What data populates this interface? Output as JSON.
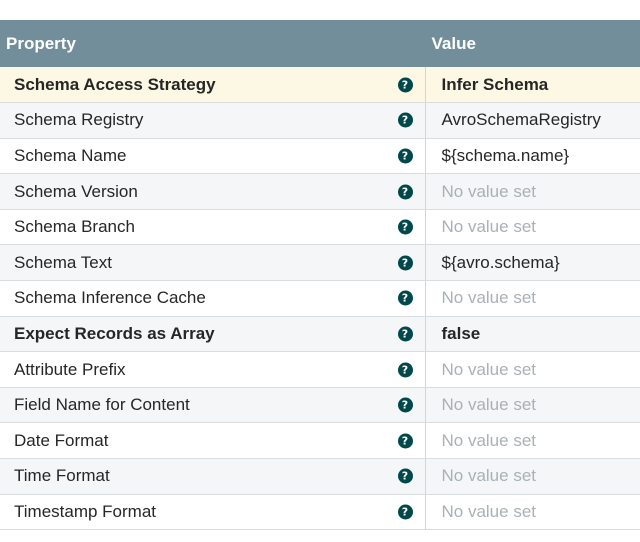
{
  "header": {
    "property_label": "Property",
    "value_label": "Value"
  },
  "help_glyph": "?",
  "colors": {
    "header_bg": "#728e9b",
    "required_row_bg": "#fdf8e4",
    "help_icon_bg": "#004849",
    "no_value_text": "#a9b1b5"
  },
  "rows": [
    {
      "name": "Schema Access Strategy",
      "value": "Infer Schema"
    },
    {
      "name": "Schema Registry",
      "value": "AvroSchemaRegistry"
    },
    {
      "name": "Schema Name",
      "value": "${schema.name}"
    },
    {
      "name": "Schema Version",
      "value": "No value set"
    },
    {
      "name": "Schema Branch",
      "value": "No value set"
    },
    {
      "name": "Schema Text",
      "value": "${avro.schema}"
    },
    {
      "name": "Schema Inference Cache",
      "value": "No value set"
    },
    {
      "name": "Expect Records as Array",
      "value": "false"
    },
    {
      "name": "Attribute Prefix",
      "value": "No value set"
    },
    {
      "name": "Field Name for Content",
      "value": "No value set"
    },
    {
      "name": "Date Format",
      "value": "No value set"
    },
    {
      "name": "Time Format",
      "value": "No value set"
    },
    {
      "name": "Timestamp Format",
      "value": "No value set"
    }
  ]
}
